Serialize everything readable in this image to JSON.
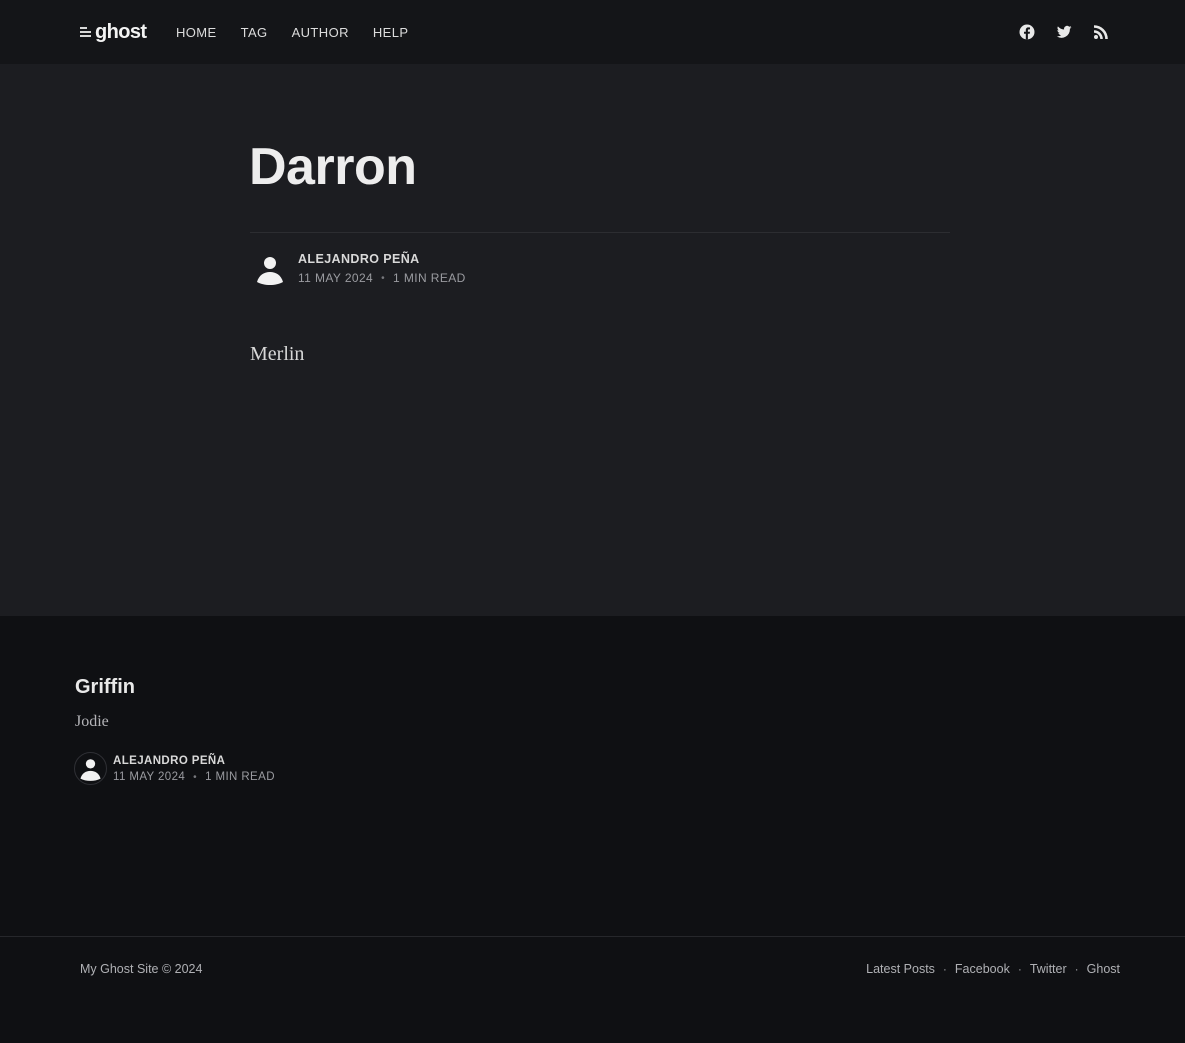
{
  "header": {
    "logo_text": "ghost",
    "nav": [
      {
        "label": "HOME"
      },
      {
        "label": "TAG"
      },
      {
        "label": "AUTHOR"
      },
      {
        "label": "HELP"
      }
    ],
    "social_icons": [
      "facebook-icon",
      "twitter-icon",
      "rss-icon"
    ]
  },
  "article": {
    "title": "Darron",
    "author": "ALEJANDRO PEÑA",
    "date": "11 MAY 2024",
    "read_time": "1 MIN READ",
    "content": "Merlin"
  },
  "feed": {
    "title": "Griffin",
    "excerpt": "Jodie",
    "author": "ALEJANDRO PEÑA",
    "date": "11 MAY 2024",
    "read_time": "1 MIN READ"
  },
  "footer": {
    "copyright": "My Ghost Site © 2024",
    "links": [
      {
        "label": "Latest Posts"
      },
      {
        "label": "Facebook"
      },
      {
        "label": "Twitter"
      },
      {
        "label": "Ghost"
      }
    ]
  },
  "colors": {
    "header_bg": "#141518",
    "article_bg": "#1c1d21",
    "page_bg": "#0f1013"
  }
}
